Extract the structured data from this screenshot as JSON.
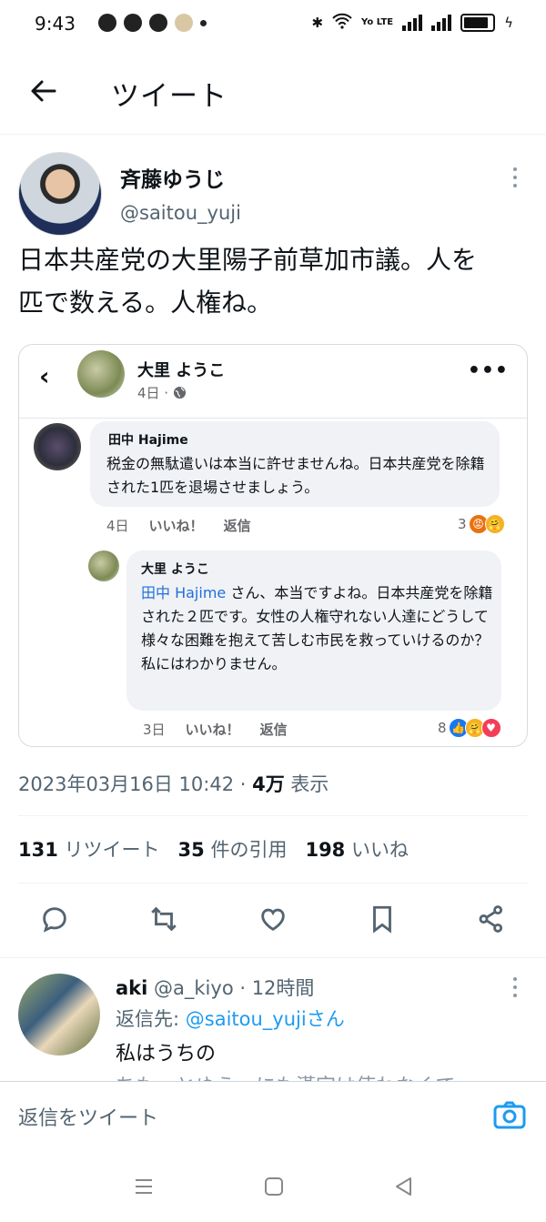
{
  "status_bar": {
    "time": "9:43",
    "network": "Yo LTE",
    "battery_level": 0.9
  },
  "header": {
    "back_icon": "arrow-left-icon",
    "title": "ツイート"
  },
  "tweet": {
    "author_name": "斉藤ゆうじ",
    "author_handle": "@saitou_yuji",
    "text_line1": "日本共産党の大里陽子前草加市議。人を",
    "text_line2": "匹で数える。人権ね。",
    "date": "2023年03月16日 10:42 · ",
    "views_count": "4万",
    "views_label": " 表示",
    "retweets_count": "131",
    "retweets_label": "リツイート",
    "quotes_count": "35",
    "quotes_label": "件の引用",
    "likes_count": "198",
    "likes_label": "いいね"
  },
  "embedded_post": {
    "poster_name": "大里 ようこ",
    "poster_date": "4日 ·",
    "menu": "•••",
    "comment1": {
      "name": "田中 Hajime",
      "text": "税金の無駄遣いは本当に許せませんね。日本共産党を除籍された1匹を退場させましょう。",
      "time": "4日",
      "like": "いいね！",
      "reply": "返信",
      "reaction_count": "3"
    },
    "comment2": {
      "name": "大里 ようこ",
      "mention": "田中 Hajime",
      "text": " さん、本当ですよね。日本共産党を除籍された２匹です。女性の人権守れない人達にどうして様々な困難を抱えて苦しむ市民を救っていけるのか？私にはわかりません。",
      "time": "3日",
      "like": "いいね！",
      "reply": "返信",
      "reaction_count": "8"
    }
  },
  "reply": {
    "name": "aki",
    "handle": "@a_kiyo",
    "time": " · 12時間",
    "reply_to_label": "返信先: ",
    "reply_to_handle": "@saitou_yujiさん",
    "text": "私はうちの",
    "cut_text": "ちも…とゆう…にも漢字は使わなくて"
  },
  "compose": {
    "placeholder": "返信をツイート",
    "camera_icon": "camera-icon"
  },
  "colors": {
    "accent": "#1d9bf0",
    "secondary_text": "#536471",
    "fb_link": "#216fdb"
  }
}
